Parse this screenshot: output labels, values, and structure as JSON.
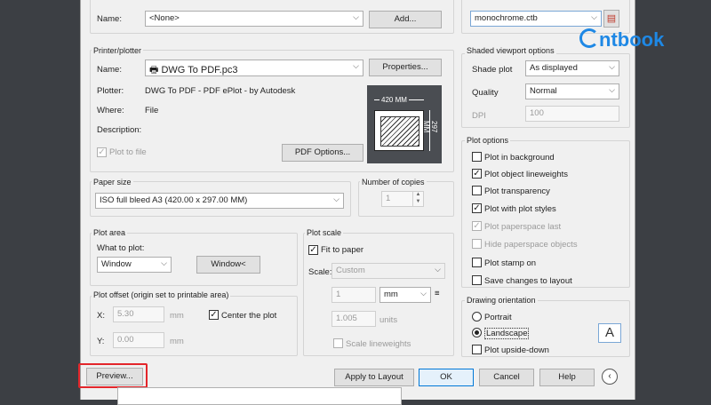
{
  "brand": {
    "logo_text": "ntbook"
  },
  "page_setup": {
    "name_label": "Name:",
    "name_value": "<None>",
    "add_button": "Add..."
  },
  "style_table": {
    "value": "monochrome.ctb"
  },
  "printer": {
    "title": "Printer/plotter",
    "name_label": "Name:",
    "name_value": "DWG To PDF.pc3",
    "properties_button": "Properties...",
    "plotter_label": "Plotter:",
    "plotter_value": "DWG To PDF - PDF ePlot - by Autodesk",
    "where_label": "Where:",
    "where_value": "File",
    "description_label": "Description:",
    "plot_to_file": "Plot to file",
    "pdf_options_button": "PDF Options...",
    "preview_width": "420 MM",
    "preview_height": "297 MM"
  },
  "paper_size": {
    "title": "Paper size",
    "value": "ISO full bleed A3 (420.00 x 297.00 MM)"
  },
  "copies": {
    "title": "Number of copies",
    "value": "1"
  },
  "plot_area": {
    "title": "Plot area",
    "what_label": "What to plot:",
    "what_value": "Window",
    "window_button": "Window<"
  },
  "plot_offset": {
    "title": "Plot offset (origin set to printable area)",
    "x_label": "X:",
    "x_value": "5.30",
    "y_label": "Y:",
    "y_value": "0.00",
    "unit": "mm",
    "center": "Center the plot"
  },
  "plot_scale": {
    "title": "Plot scale",
    "fit": "Fit to paper",
    "scale_label": "Scale:",
    "scale_value": "Custom",
    "val1": "1",
    "unit_value": "mm",
    "val2": "1.005",
    "units": "units",
    "lineweights": "Scale lineweights"
  },
  "shaded": {
    "title": "Shaded viewport options",
    "shade_label": "Shade plot",
    "shade_value": "As displayed",
    "quality_label": "Quality",
    "quality_value": "Normal",
    "dpi_label": "DPI",
    "dpi_value": "100"
  },
  "plot_options": {
    "title": "Plot options",
    "items": [
      "Plot in background",
      "Plot object lineweights",
      "Plot transparency",
      "Plot with plot styles",
      "Plot paperspace last",
      "Hide paperspace objects",
      "Plot stamp on",
      "Save changes to layout"
    ]
  },
  "orientation": {
    "title": "Drawing orientation",
    "portrait": "Portrait",
    "landscape": "Landscape",
    "upside": "Plot upside-down",
    "icon_letter": "A"
  },
  "footer": {
    "preview": "Preview...",
    "apply": "Apply to Layout",
    "ok": "OK",
    "cancel": "Cancel",
    "help": "Help"
  }
}
